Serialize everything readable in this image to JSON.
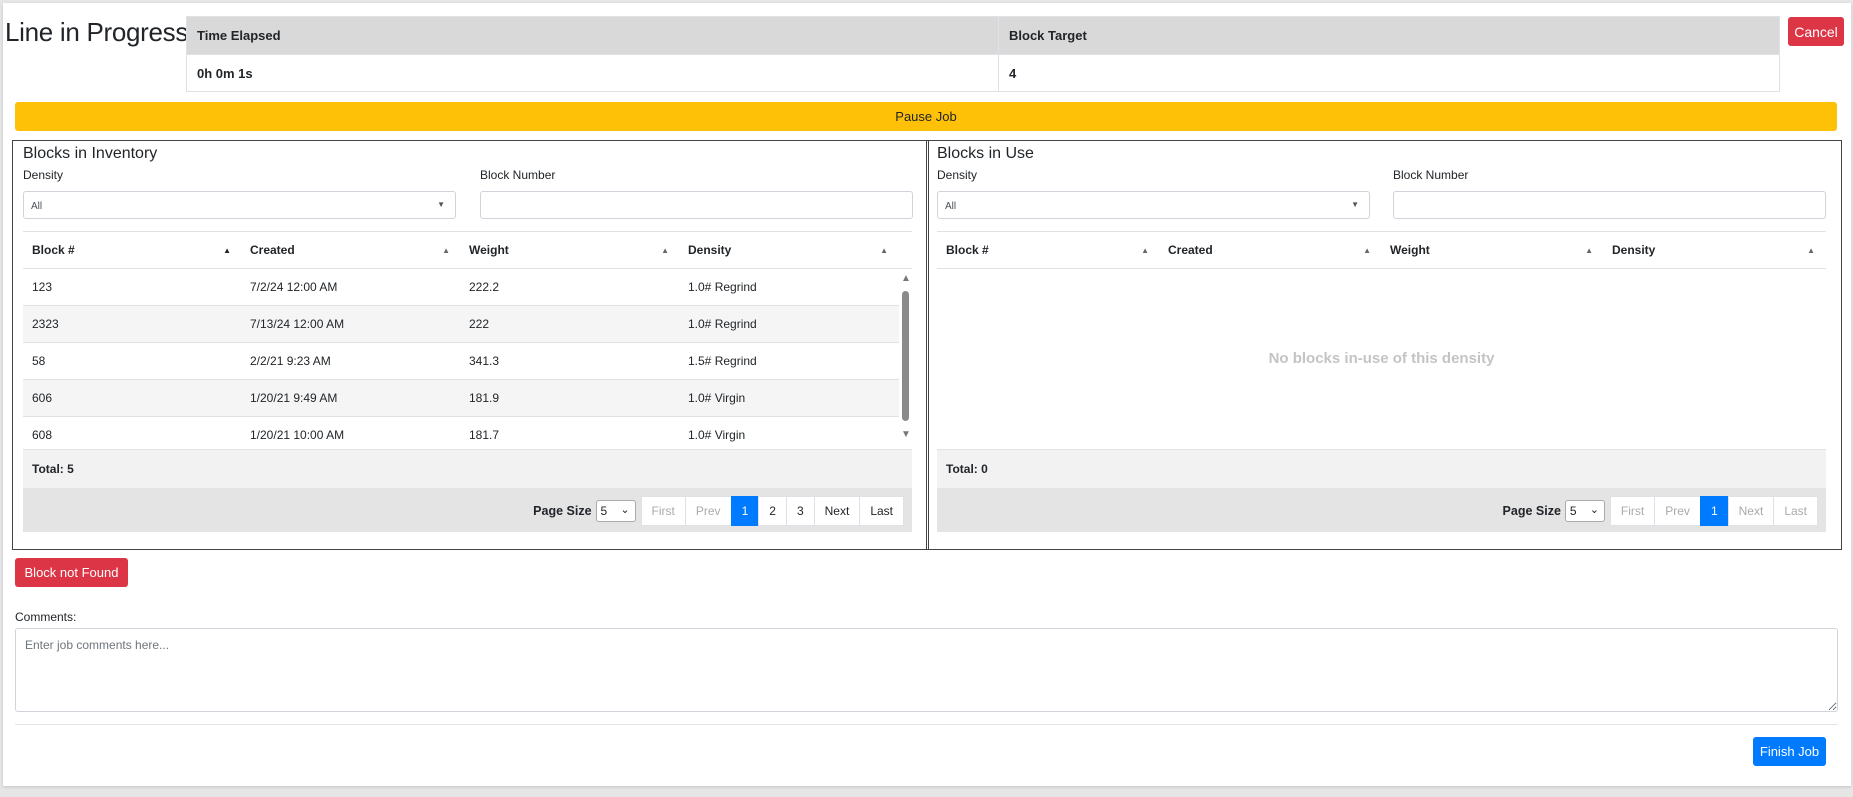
{
  "page_title": "Line in Progress",
  "summary": {
    "headers": [
      "Time Elapsed",
      "Block Target"
    ],
    "values": [
      "0h 0m 1s",
      "4"
    ]
  },
  "buttons": {
    "cancel": "Cancel",
    "pause": "Pause Job",
    "block_not_found": "Block not Found",
    "finish": "Finish Job"
  },
  "inventory": {
    "title": "Blocks in Inventory",
    "density_label": "Density",
    "density_value": "All",
    "block_number_label": "Block Number",
    "columns": [
      "Block #",
      "Created",
      "Weight",
      "Density"
    ],
    "rows": [
      [
        "123",
        "7/2/24 12:00 AM",
        "222.2",
        "1.0# Regrind"
      ],
      [
        "2323",
        "7/13/24 12:00 AM",
        "222",
        "1.0# Regrind"
      ],
      [
        "58",
        "2/2/21 9:23 AM",
        "341.3",
        "1.5# Regrind"
      ],
      [
        "606",
        "1/20/21 9:49 AM",
        "181.9",
        "1.0# Virgin"
      ],
      [
        "608",
        "1/20/21 10:00 AM",
        "181.7",
        "1.0# Virgin"
      ]
    ],
    "total": "Total: 5",
    "page_size_label": "Page Size",
    "page_size": "5",
    "pager": {
      "first": "First",
      "prev": "Prev",
      "pages": [
        "1",
        "2",
        "3"
      ],
      "next": "Next",
      "last": "Last"
    }
  },
  "in_use": {
    "title": "Blocks in Use",
    "density_label": "Density",
    "density_value": "All",
    "block_number_label": "Block Number",
    "columns": [
      "Block #",
      "Created",
      "Weight",
      "Density"
    ],
    "empty_message": "No blocks in-use of this density",
    "total": "Total: 0",
    "page_size_label": "Page Size",
    "page_size": "5",
    "pager": {
      "first": "First",
      "prev": "Prev",
      "pages": [
        "1"
      ],
      "next": "Next",
      "last": "Last"
    }
  },
  "comments": {
    "label": "Comments:",
    "placeholder": "Enter job comments here..."
  },
  "colors": {
    "danger": "#dc3545",
    "warning": "#ffc107",
    "primary": "#007bff"
  }
}
